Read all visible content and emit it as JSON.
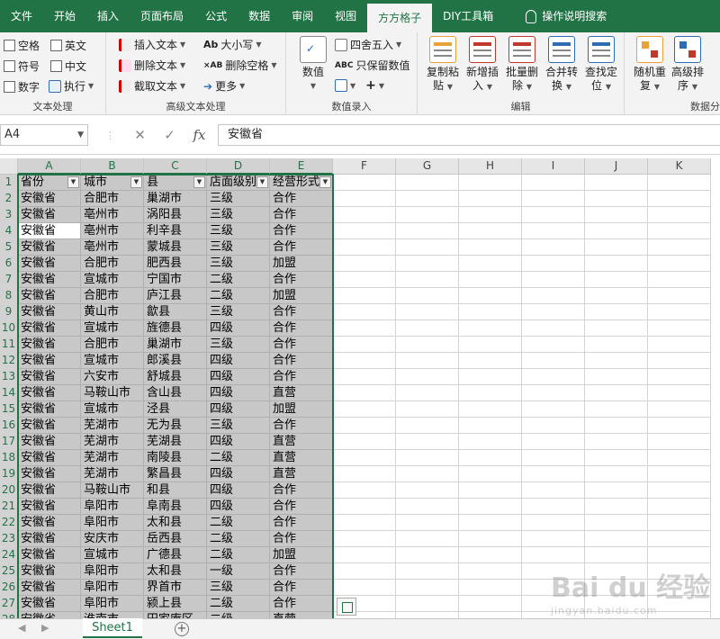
{
  "tabs": [
    {
      "label": "文件",
      "active": false
    },
    {
      "label": "开始",
      "active": false
    },
    {
      "label": "插入",
      "active": false
    },
    {
      "label": "页面布局",
      "active": false
    },
    {
      "label": "公式",
      "active": false
    },
    {
      "label": "数据",
      "active": false
    },
    {
      "label": "审阅",
      "active": false
    },
    {
      "label": "视图",
      "active": false
    },
    {
      "label": "方方格子",
      "active": true
    },
    {
      "label": "DIY工具箱",
      "active": false
    }
  ],
  "tell_me": "操作说明搜索",
  "ribbon": {
    "text_group": {
      "label": "文本处理",
      "checks": [
        "空格",
        "英文",
        "符号",
        "中文",
        "数字"
      ],
      "execute": "执行"
    },
    "adv_text_group": {
      "label": "高级文本处理",
      "insert_text": "插入文本",
      "delete_text": "删除文本",
      "extract_text": "截取文本",
      "case": "大小写",
      "delete_spaces": "删除空格",
      "more": "更多"
    },
    "value_group": {
      "label": "数值录入",
      "value": "数值",
      "round": "四舍五入",
      "keep_value": "只保留数值"
    },
    "edit_group": {
      "label": "编辑",
      "buttons": [
        {
          "line1": "复制粘",
          "line2": "贴"
        },
        {
          "line1": "新增插",
          "line2": "入"
        },
        {
          "line1": "批量删",
          "line2": "除"
        },
        {
          "line1": "合并转",
          "line2": "换"
        },
        {
          "line1": "查找定",
          "line2": "位"
        }
      ]
    },
    "data_group": {
      "label": "数据分",
      "buttons": [
        {
          "line1": "随机重",
          "line2": "复"
        },
        {
          "line1": "高级排",
          "line2": "序"
        }
      ]
    }
  },
  "name_box": "A4",
  "formula_value": "安徽省",
  "columns": [
    "A",
    "B",
    "C",
    "D",
    "E",
    "F",
    "G",
    "H",
    "I",
    "J",
    "K"
  ],
  "headers": [
    "省份",
    "城市",
    "县",
    "店面级别",
    "经营形式"
  ],
  "rows": [
    [
      "安徽省",
      "合肥市",
      "巢湖市",
      "三级",
      "合作"
    ],
    [
      "安徽省",
      "亳州市",
      "涡阳县",
      "三级",
      "合作"
    ],
    [
      "安徽省",
      "亳州市",
      "利辛县",
      "三级",
      "合作"
    ],
    [
      "安徽省",
      "亳州市",
      "蒙城县",
      "三级",
      "合作"
    ],
    [
      "安徽省",
      "合肥市",
      "肥西县",
      "三级",
      "加盟"
    ],
    [
      "安徽省",
      "宣城市",
      "宁国市",
      "二级",
      "合作"
    ],
    [
      "安徽省",
      "合肥市",
      "庐江县",
      "二级",
      "加盟"
    ],
    [
      "安徽省",
      "黄山市",
      "歙县",
      "三级",
      "合作"
    ],
    [
      "安徽省",
      "宣城市",
      "旌德县",
      "四级",
      "合作"
    ],
    [
      "安徽省",
      "合肥市",
      "巢湖市",
      "三级",
      "合作"
    ],
    [
      "安徽省",
      "宣城市",
      "郎溪县",
      "四级",
      "合作"
    ],
    [
      "安徽省",
      "六安市",
      "舒城县",
      "四级",
      "合作"
    ],
    [
      "安徽省",
      "马鞍山市",
      "含山县",
      "四级",
      "直营"
    ],
    [
      "安徽省",
      "宣城市",
      "泾县",
      "四级",
      "加盟"
    ],
    [
      "安徽省",
      "芜湖市",
      "无为县",
      "三级",
      "合作"
    ],
    [
      "安徽省",
      "芜湖市",
      "芜湖县",
      "四级",
      "直营"
    ],
    [
      "安徽省",
      "芜湖市",
      "南陵县",
      "二级",
      "直营"
    ],
    [
      "安徽省",
      "芜湖市",
      "繁昌县",
      "四级",
      "直营"
    ],
    [
      "安徽省",
      "马鞍山市",
      "和县",
      "四级",
      "合作"
    ],
    [
      "安徽省",
      "阜阳市",
      "阜南县",
      "四级",
      "合作"
    ],
    [
      "安徽省",
      "阜阳市",
      "太和县",
      "二级",
      "合作"
    ],
    [
      "安徽省",
      "安庆市",
      "岳西县",
      "二级",
      "合作"
    ],
    [
      "安徽省",
      "宣城市",
      "广德县",
      "二级",
      "加盟"
    ],
    [
      "安徽省",
      "阜阳市",
      "太和县",
      "一级",
      "合作"
    ],
    [
      "安徽省",
      "阜阳市",
      "界首市",
      "三级",
      "合作"
    ],
    [
      "安徽省",
      "阜阳市",
      "颍上县",
      "二级",
      "合作"
    ],
    [
      "安徽省",
      "淮南市",
      "田家庵区",
      "二级",
      "直营"
    ]
  ],
  "sheet_tab": "Sheet1",
  "watermark": {
    "brand": "Bai du 经验",
    "url": "jingyan.baidu.com"
  },
  "colors": {
    "excel_green": "#217346",
    "selection_fill": "#c8c8c8"
  }
}
